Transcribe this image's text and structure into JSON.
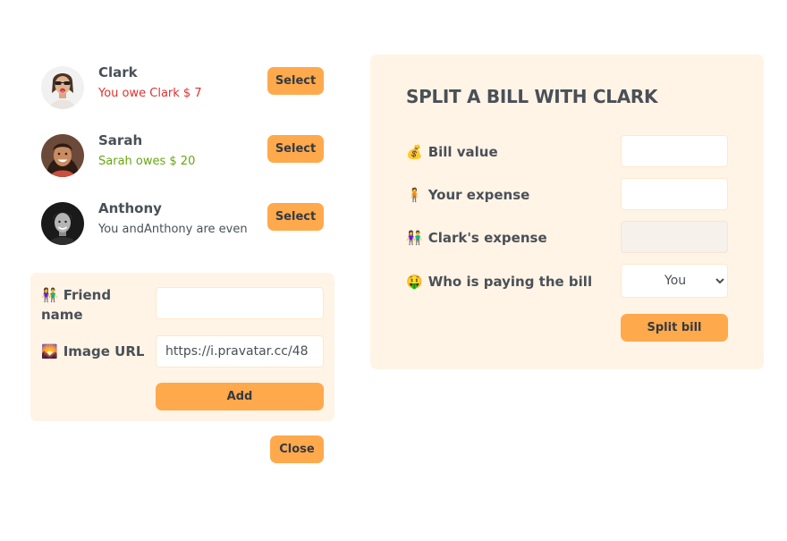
{
  "friends": [
    {
      "name": "Clark",
      "status": "You owe Clark $ 7",
      "status_type": "owe",
      "avatar_icon": "avatar-clark-icon",
      "select_label": "Select"
    },
    {
      "name": "Sarah",
      "status": "Sarah owes $ 20",
      "status_type": "owed",
      "avatar_icon": "avatar-sarah-icon",
      "select_label": "Select"
    },
    {
      "name": "Anthony",
      "status": "You andAnthony are even",
      "status_type": "even",
      "avatar_icon": "avatar-anthony-icon",
      "select_label": "Select"
    }
  ],
  "add_form": {
    "friend_name_emoji": "👫",
    "friend_name_label": "Friend name",
    "friend_name_value": "",
    "image_url_emoji": "🌄",
    "image_url_label": "Image URL",
    "image_url_value": "https://i.pravatar.cc/48",
    "add_label": "Add"
  },
  "close_label": "Close",
  "split_form": {
    "title": "SPLIT A BILL WITH CLARK",
    "bill_value_emoji": "💰",
    "bill_value_label": "Bill value",
    "bill_value": "",
    "your_expense_emoji": "🧍",
    "your_expense_label": "Your expense",
    "your_expense": "",
    "friend_expense_emoji": "👫",
    "friend_expense_label": "Clark's expense",
    "friend_expense": "",
    "payer_emoji": "🤑",
    "payer_label": "Who is paying the bill",
    "payer_selected": "You",
    "split_label": "Split bill"
  },
  "colors": {
    "accent": "#ffa94d",
    "panel": "#fff4e6",
    "owe": "#e03131",
    "owed": "#66a80f",
    "text": "#495057"
  }
}
